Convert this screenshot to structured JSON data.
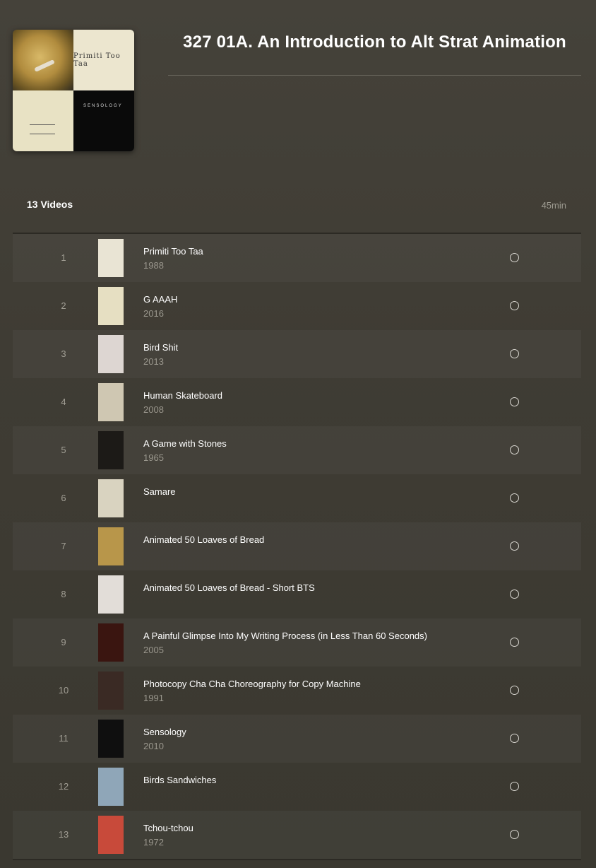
{
  "collection": {
    "title": "327 01A. An Introduction to Alt Strat Animation",
    "cover_text": {
      "primiti": "Primiti Too Taa",
      "sensology": "SENSOLOGY"
    }
  },
  "summary": {
    "count_label": "13 Videos",
    "duration_label": "45min"
  },
  "videos": [
    {
      "index": "1",
      "title": "Primiti Too Taa",
      "year": "1988",
      "thumb_color": "#e9e4d4"
    },
    {
      "index": "2",
      "title": "G AAAH",
      "year": "2016",
      "thumb_color": "#e6dfc2"
    },
    {
      "index": "3",
      "title": "Bird Shit",
      "year": "2013",
      "thumb_color": "#ddd6d2"
    },
    {
      "index": "4",
      "title": "Human Skateboard",
      "year": "2008",
      "thumb_color": "#cfc7b2"
    },
    {
      "index": "5",
      "title": "A Game with Stones",
      "year": "1965",
      "thumb_color": "#1c1a17"
    },
    {
      "index": "6",
      "title": "Samare",
      "year": "",
      "thumb_color": "#d9d3c0"
    },
    {
      "index": "7",
      "title": "Animated 50 Loaves of Bread",
      "year": "",
      "thumb_color": "#b8964a"
    },
    {
      "index": "8",
      "title": "Animated 50 Loaves of Bread - Short BTS",
      "year": "",
      "thumb_color": "#e2ddd8"
    },
    {
      "index": "9",
      "title": "A Painful Glimpse Into My Writing Process (in Less Than 60 Seconds)",
      "year": "2005",
      "thumb_color": "#3a1510"
    },
    {
      "index": "10",
      "title": "Photocopy Cha Cha Choreography for Copy Machine",
      "year": "1991",
      "thumb_color": "#3a2a24"
    },
    {
      "index": "11",
      "title": "Sensology",
      "year": "2010",
      "thumb_color": "#0f0f0f"
    },
    {
      "index": "12",
      "title": "Birds Sandwiches",
      "year": "",
      "thumb_color": "#8fa6b8"
    },
    {
      "index": "13",
      "title": "Tchou-tchou",
      "year": "1972",
      "thumb_color": "#c84a3a"
    }
  ]
}
